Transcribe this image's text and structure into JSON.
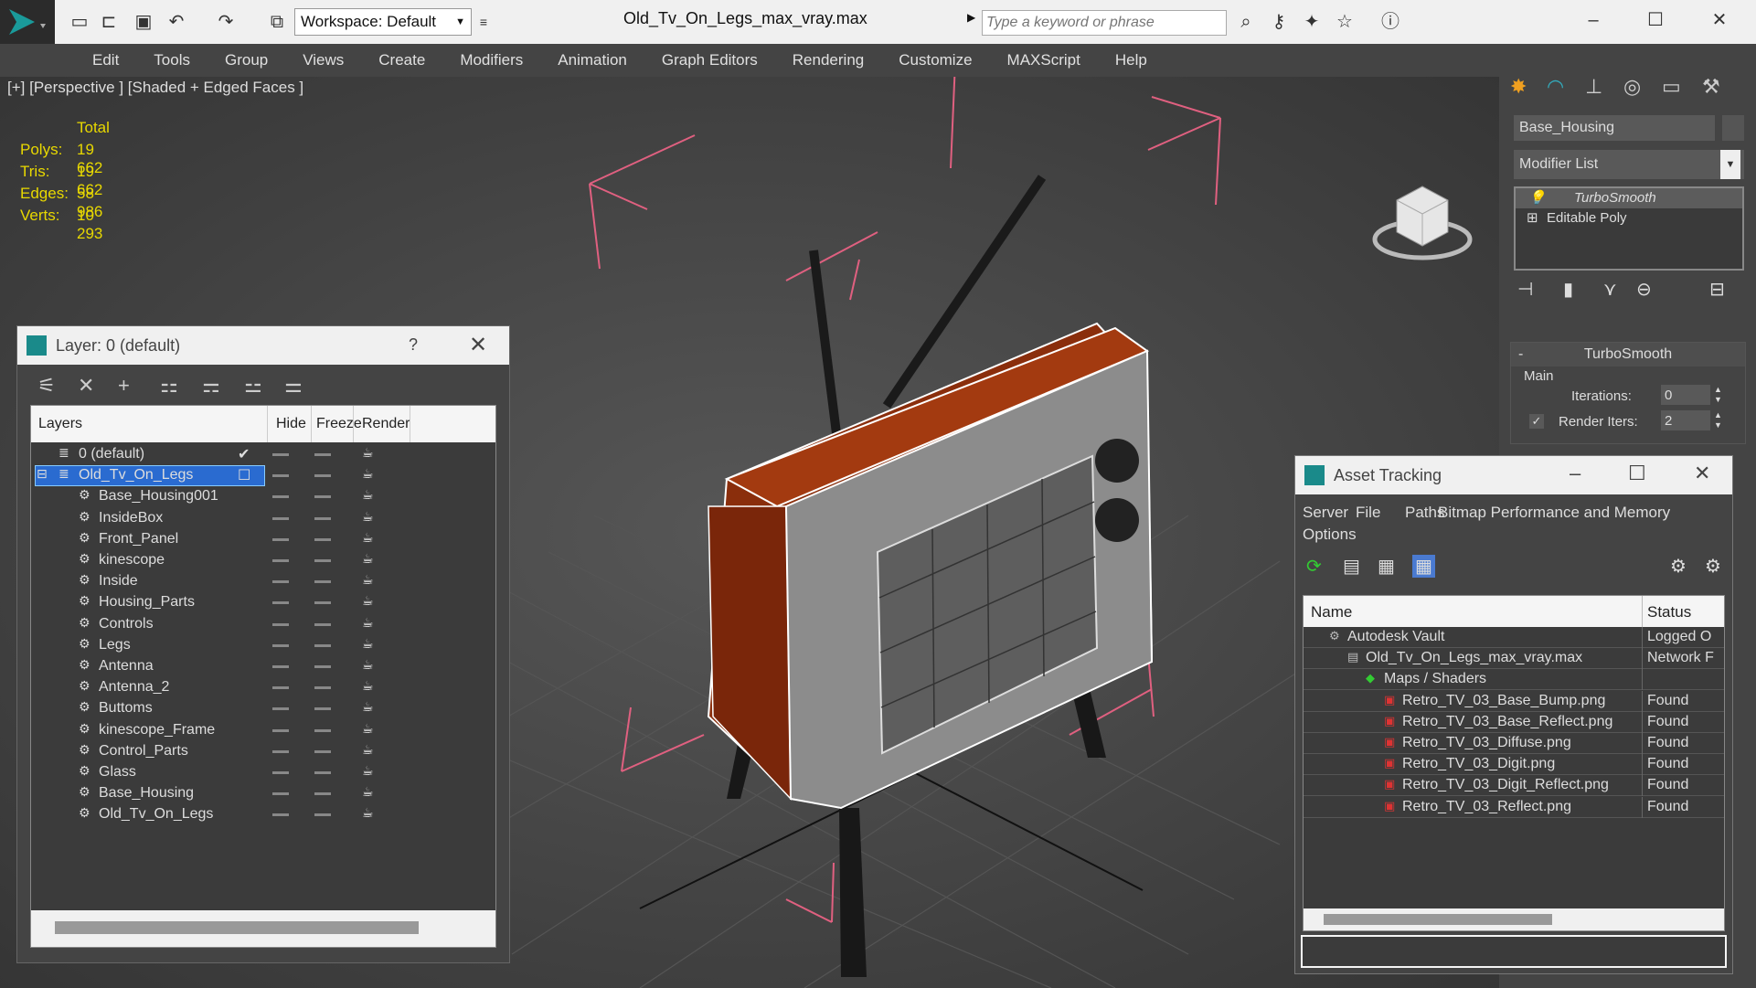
{
  "window": {
    "title": "Old_Tv_On_Legs_max_vray.max"
  },
  "toolbar": {
    "workspace_label": "Workspace: Default",
    "search_placeholder": "Type a keyword or phrase"
  },
  "menu": [
    "Edit",
    "Tools",
    "Group",
    "Views",
    "Create",
    "Modifiers",
    "Animation",
    "Graph Editors",
    "Rendering",
    "Customize",
    "MAXScript",
    "Help"
  ],
  "viewport": {
    "label": "[+] [Perspective ] [Shaded + Edged Faces ]",
    "stats": {
      "header": "Total",
      "rows": [
        [
          "Polys:",
          "19 662"
        ],
        [
          "Tris:",
          "19 662"
        ],
        [
          "Edges:",
          "58 986"
        ],
        [
          "Verts:",
          "10 293"
        ]
      ]
    }
  },
  "layer_panel": {
    "title": "Layer: 0 (default)",
    "help": "?",
    "columns": [
      "Layers",
      "Hide",
      "Freeze",
      "Render"
    ],
    "rows": [
      {
        "name": "0 (default)",
        "indent": 0
      },
      {
        "name": "Old_Tv_On_Legs",
        "indent": 0,
        "selected": true
      },
      {
        "name": "Base_Housing001",
        "indent": 1
      },
      {
        "name": "InsideBox",
        "indent": 1
      },
      {
        "name": "Front_Panel",
        "indent": 1
      },
      {
        "name": "kinescope",
        "indent": 1
      },
      {
        "name": "Inside",
        "indent": 1
      },
      {
        "name": "Housing_Parts",
        "indent": 1
      },
      {
        "name": "Controls",
        "indent": 1
      },
      {
        "name": "Legs",
        "indent": 1
      },
      {
        "name": "Antenna",
        "indent": 1
      },
      {
        "name": "Antenna_2",
        "indent": 1
      },
      {
        "name": "Buttoms",
        "indent": 1
      },
      {
        "name": "kinescope_Frame",
        "indent": 1
      },
      {
        "name": "Control_Parts",
        "indent": 1
      },
      {
        "name": "Glass",
        "indent": 1
      },
      {
        "name": "Base_Housing",
        "indent": 1
      },
      {
        "name": "Old_Tv_On_Legs",
        "indent": 1
      }
    ]
  },
  "command_panel": {
    "object_name": "Base_Housing",
    "modifier_list": "Modifier List",
    "stack": [
      "TurboSmooth",
      "Editable Poly"
    ],
    "rollout_title": "TurboSmooth",
    "group": "Main",
    "iterations_label": "Iterations:",
    "iterations_value": "0",
    "render_iters_label": "Render Iters:",
    "render_iters_value": "2"
  },
  "asset_tracking": {
    "title": "Asset Tracking",
    "menu": [
      "Server",
      "File",
      "Paths",
      "Bitmap Performance and Memory",
      "Options"
    ],
    "columns": [
      "Name",
      "Status"
    ],
    "rows": [
      {
        "name": "Autodesk Vault",
        "status": "Logged O",
        "indent": 1
      },
      {
        "name": "Old_Tv_On_Legs_max_vray.max",
        "status": "Network F",
        "indent": 2
      },
      {
        "name": "Maps / Shaders",
        "status": "",
        "indent": 3
      },
      {
        "name": "Retro_TV_03_Base_Bump.png",
        "status": "Found",
        "indent": 4
      },
      {
        "name": "Retro_TV_03_Base_Reflect.png",
        "status": "Found",
        "indent": 4
      },
      {
        "name": "Retro_TV_03_Diffuse.png",
        "status": "Found",
        "indent": 4
      },
      {
        "name": "Retro_TV_03_Digit.png",
        "status": "Found",
        "indent": 4
      },
      {
        "name": "Retro_TV_03_Digit_Reflect.png",
        "status": "Found",
        "indent": 4
      },
      {
        "name": "Retro_TV_03_Reflect.png",
        "status": "Found",
        "indent": 4
      }
    ]
  }
}
